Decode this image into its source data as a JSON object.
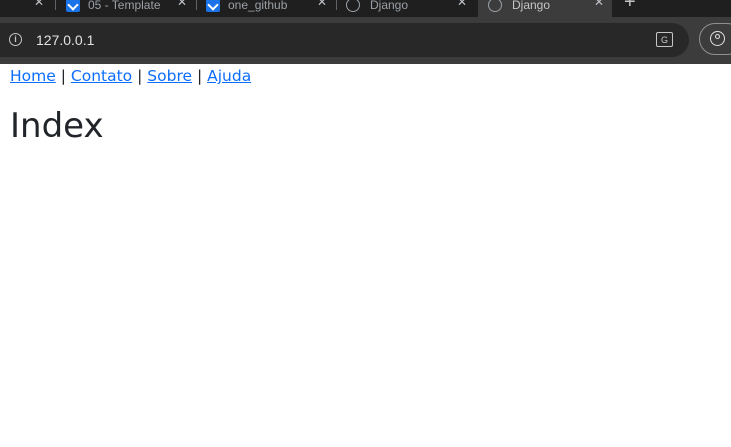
{
  "browser": {
    "tabs": [
      {
        "title": "r",
        "active": false
      },
      {
        "title": "05 - Template",
        "active": false
      },
      {
        "title": "one_github",
        "active": false
      },
      {
        "title": "Django",
        "active": false
      },
      {
        "title": "Django",
        "active": true
      }
    ],
    "close_glyph": "✕",
    "new_tab_glyph": "+",
    "address": "127.0.0.1",
    "translate_glyph": "文A"
  },
  "page": {
    "nav": [
      {
        "label": "Home"
      },
      {
        "label": "Contato"
      },
      {
        "label": "Sobre"
      },
      {
        "label": "Ajuda"
      }
    ],
    "separator": "|",
    "heading": "Index"
  },
  "colors": {
    "link": "#0d6efd",
    "text": "#212529",
    "browser_frame": "#1f1f1f",
    "toolbar": "#3c3c3c",
    "omnibox": "#282828"
  }
}
